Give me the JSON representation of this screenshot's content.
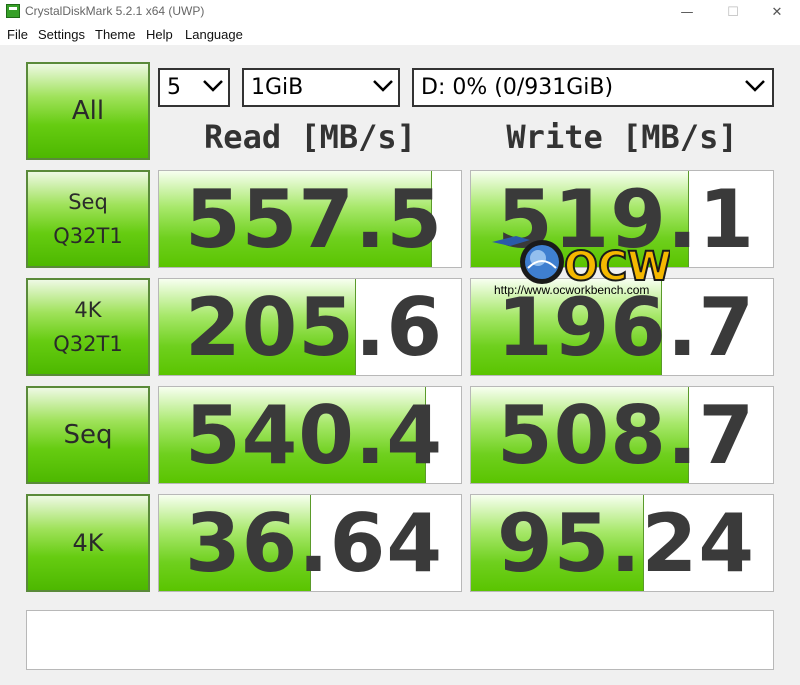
{
  "window": {
    "title": "CrystalDiskMark 5.2.1 x64 (UWP)",
    "minimize_glyph": "—",
    "maximize_glyph": "☐",
    "close_glyph": "✕"
  },
  "menu": [
    "File",
    "Settings",
    "Theme",
    "Help",
    "Language"
  ],
  "controls": {
    "all_label": "All",
    "count": "5",
    "size": "1GiB",
    "drive": "D: 0% (0/931GiB)"
  },
  "headers": {
    "read": "Read [MB/s]",
    "write": "Write [MB/s]"
  },
  "tests": [
    {
      "label_line1": "Seq",
      "label_line2": "Q32T1",
      "read": "557.5",
      "write": "519.1",
      "read_fill": 0.9,
      "write_fill": 0.72
    },
    {
      "label_line1": "4K",
      "label_line2": "Q32T1",
      "read": "205.6",
      "write": "196.7",
      "read_fill": 0.65,
      "write_fill": 0.63
    },
    {
      "label_line1": "Seq",
      "label_line2": "",
      "read": "540.4",
      "write": "508.7",
      "read_fill": 0.88,
      "write_fill": 0.72
    },
    {
      "label_line1": "4K",
      "label_line2": "",
      "read": "36.64",
      "write": "95.24",
      "read_fill": 0.5,
      "write_fill": 0.57
    }
  ],
  "comment": "",
  "watermark": {
    "logo_text": "OCW",
    "url": "http://www.ocworkbench.com"
  },
  "colors": {
    "accent": "#66cc11",
    "border": "#5a8a3a",
    "number": "#3a3a3a"
  }
}
